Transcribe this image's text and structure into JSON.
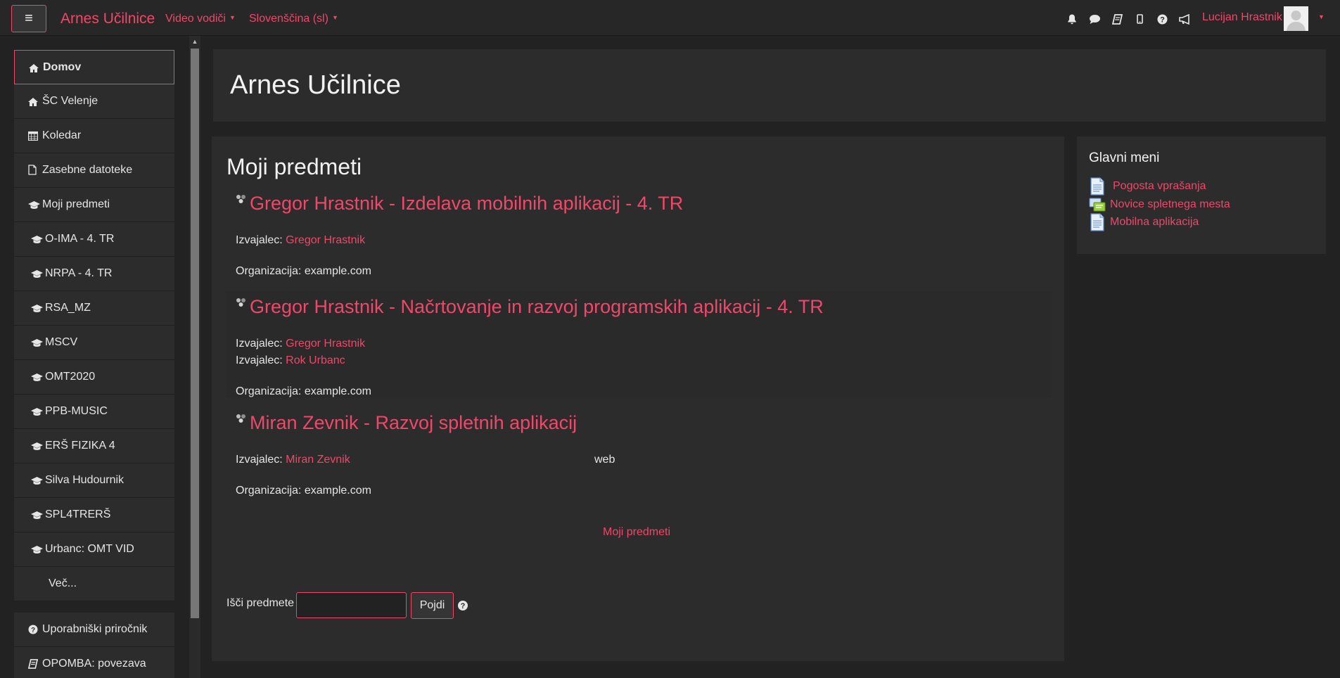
{
  "navbar": {
    "brand": "Arnes Učilnice",
    "menu": [
      {
        "label": "Video vodiči"
      },
      {
        "label": "Slovenščina (sl)"
      }
    ],
    "icons": [
      "bell-icon",
      "chat-icon",
      "book-icon",
      "mobile-icon",
      "question-icon",
      "bullhorn-icon"
    ],
    "user_name": "Lucijan Hrastnik"
  },
  "sidebar": {
    "items": [
      {
        "label": "Domov",
        "icon": "home-icon"
      },
      {
        "label": "ŠC Velenje",
        "icon": "home-icon"
      },
      {
        "label": "Koledar",
        "icon": "calendar-icon"
      },
      {
        "label": "Zasebne datoteke",
        "icon": "file-icon"
      },
      {
        "label": "Moji predmeti",
        "icon": "graduation-cap-icon"
      }
    ],
    "courses": [
      {
        "label": "O-IMA - 4. TR"
      },
      {
        "label": "NRPA - 4. TR"
      },
      {
        "label": "RSA_MZ"
      },
      {
        "label": "MSCV"
      },
      {
        "label": "OMT2020"
      },
      {
        "label": "PPB-MUSIC"
      },
      {
        "label": "ERŠ FIZIKA 4"
      },
      {
        "label": "Silva Hudournik"
      },
      {
        "label": "SPL4TRERŠ"
      },
      {
        "label": "Urbanc: OMT VID"
      }
    ],
    "more": "Več...",
    "bottom": [
      {
        "label": "Uporabniški priročnik",
        "icon": "question-circle-icon"
      },
      {
        "label": "OPOMBA: povezava",
        "icon": "book-icon"
      }
    ]
  },
  "header": {
    "title": "Arnes Učilnice"
  },
  "main": {
    "title": "Moji predmeti",
    "courses": [
      {
        "title": "Gregor Hrastnik - Izdelava mobilnih aplikacij - 4. TR",
        "teachers": [
          {
            "role": "Izvajalec:",
            "name": "Gregor Hrastnik"
          }
        ],
        "org": "Organizacija: example.com",
        "summary": ""
      },
      {
        "title": "Gregor Hrastnik - Načrtovanje in razvoj programskih aplikacij - 4. TR",
        "teachers": [
          {
            "role": "Izvajalec:",
            "name": "Gregor Hrastnik"
          },
          {
            "role": "Izvajalec:",
            "name": "Rok Urbanc"
          }
        ],
        "org": "Organizacija: example.com",
        "summary": ""
      },
      {
        "title": "Miran Zevnik - Razvoj spletnih aplikacij",
        "teachers": [
          {
            "role": "Izvajalec:",
            "name": "Miran Zevnik"
          }
        ],
        "org": "Organizacija: example.com",
        "summary": "web"
      }
    ],
    "all_courses_link": "Moji predmeti",
    "search": {
      "label": "Išči predmete",
      "value": "",
      "button": "Pojdi"
    }
  },
  "block": {
    "title": "Glavni meni",
    "items": [
      {
        "label": "Pogosta vprašanja",
        "icon": "page-icon"
      },
      {
        "label": "Novice spletnega mesta",
        "icon": "forum-icon"
      },
      {
        "label": "Mobilna aplikacija",
        "icon": "page-icon"
      }
    ]
  },
  "colors": {
    "accent": "#f0476a",
    "background": "#222222",
    "card": "#2c2c2c"
  }
}
